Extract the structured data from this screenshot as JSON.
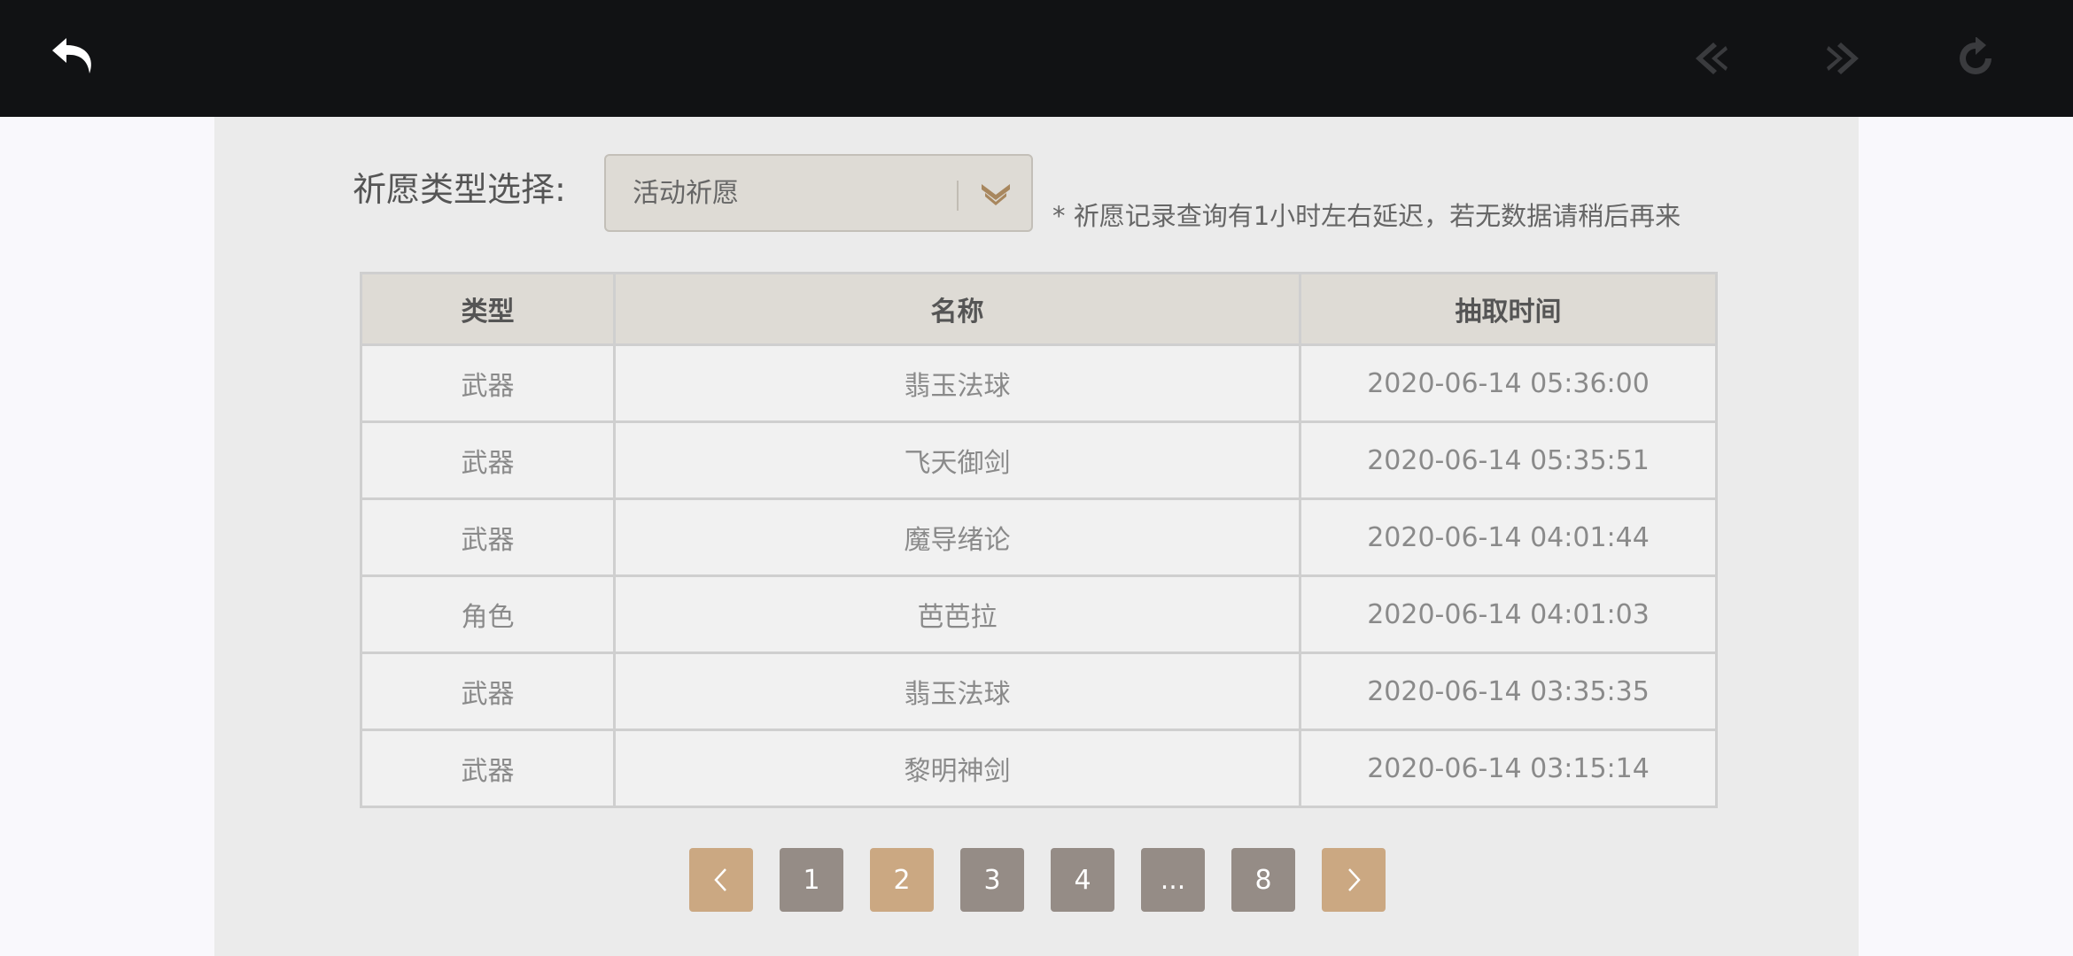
{
  "filter": {
    "label": "祈愿类型选择:",
    "selected": "活动祈愿",
    "notice": "* 祈愿记录查询有1小时左右延迟，若无数据请稍后再来"
  },
  "table": {
    "headers": [
      "类型",
      "名称",
      "抽取时间"
    ],
    "rows": [
      [
        "武器",
        "翡玉法球",
        "2020-06-14 05:36:00"
      ],
      [
        "武器",
        "飞天御剑",
        "2020-06-14 05:35:51"
      ],
      [
        "武器",
        "魔导绪论",
        "2020-06-14 04:01:44"
      ],
      [
        "角色",
        "芭芭拉",
        "2020-06-14 04:01:03"
      ],
      [
        "武器",
        "翡玉法球",
        "2020-06-14 03:35:35"
      ],
      [
        "武器",
        "黎明神剑",
        "2020-06-14 03:15:14"
      ]
    ]
  },
  "pagination": {
    "pages": [
      "1",
      "2",
      "3",
      "4",
      "...",
      "8"
    ],
    "current": "2"
  },
  "colors": {
    "topbar": "#111214",
    "panel": "#ebebeb",
    "accent": "#cba882",
    "page_button": "#958c86"
  }
}
